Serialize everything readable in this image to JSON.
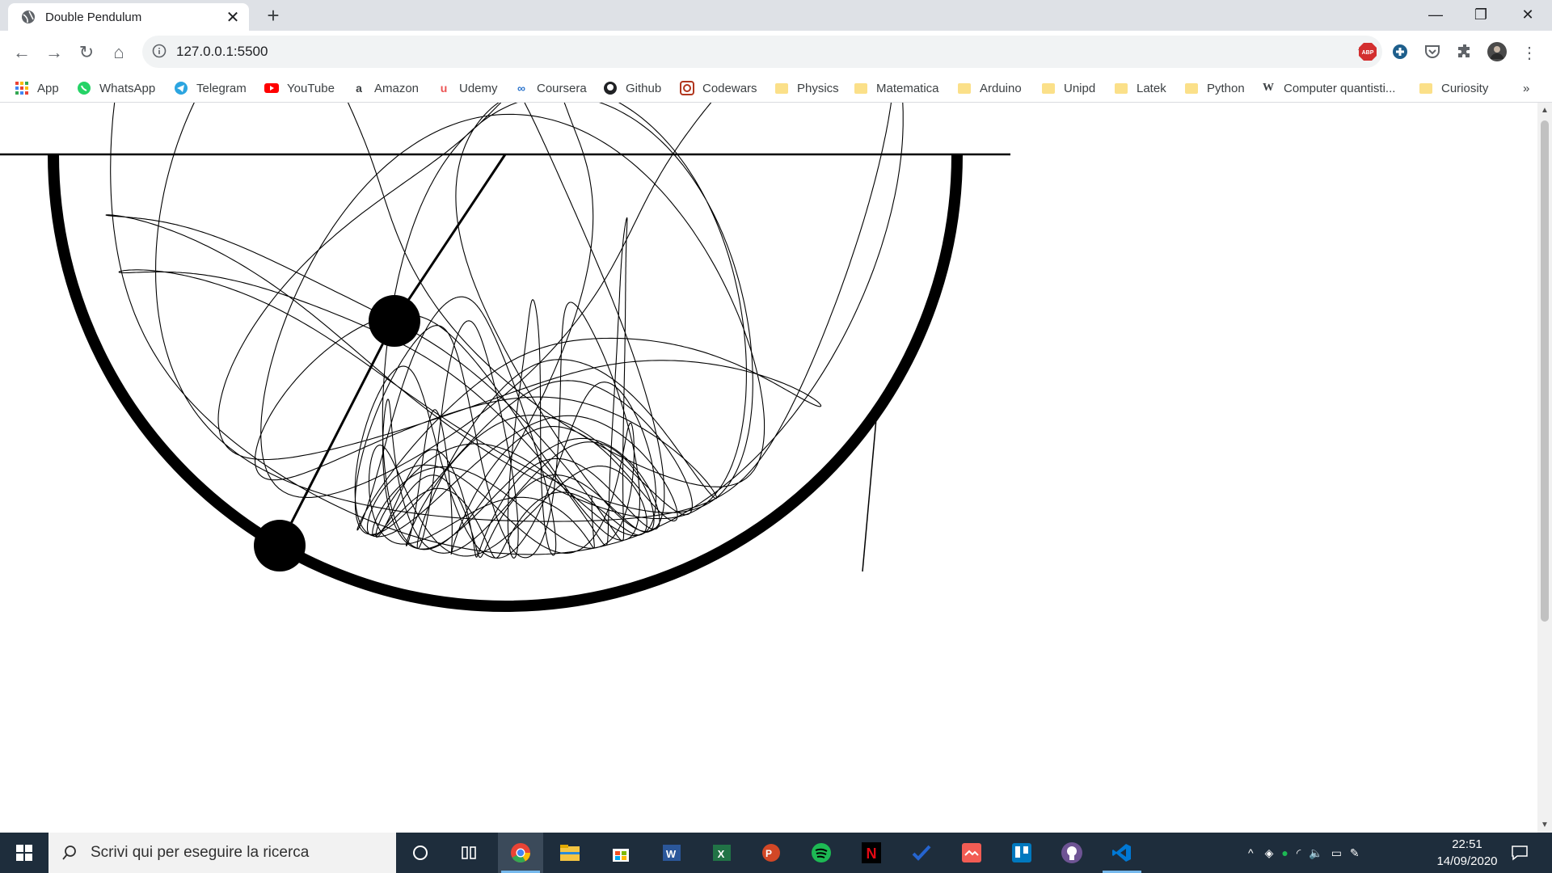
{
  "browser": {
    "tab_title": "Double Pendulum",
    "url": "127.0.0.1:5500",
    "new_tab_symbol": "+",
    "window_controls": [
      "minimize",
      "restore",
      "close"
    ]
  },
  "bookmarks": [
    {
      "label": "App",
      "icon": "apps-grid-icon"
    },
    {
      "label": "WhatsApp",
      "icon": "whatsapp-icon"
    },
    {
      "label": "Telegram",
      "icon": "telegram-icon"
    },
    {
      "label": "YouTube",
      "icon": "youtube-icon"
    },
    {
      "label": "Amazon",
      "icon": "amazon-icon"
    },
    {
      "label": "Udemy",
      "icon": "udemy-icon"
    },
    {
      "label": "Coursera",
      "icon": "coursera-icon"
    },
    {
      "label": "Github",
      "icon": "github-icon"
    },
    {
      "label": "Codewars",
      "icon": "codewars-icon"
    },
    {
      "label": "Physics",
      "icon": "folder-icon"
    },
    {
      "label": "Matematica",
      "icon": "folder-icon"
    },
    {
      "label": "Arduino",
      "icon": "folder-icon"
    },
    {
      "label": "Unipd",
      "icon": "folder-icon"
    },
    {
      "label": "Latek",
      "icon": "folder-icon"
    },
    {
      "label": "Python",
      "icon": "folder-icon"
    },
    {
      "label": "Computer quantisti...",
      "icon": "wikipedia-icon"
    },
    {
      "label": "Curiosity",
      "icon": "folder-icon"
    }
  ],
  "bookmarks_overflow": "»",
  "taskbar": {
    "search_placeholder": "Scrivi qui per eseguire la ricerca",
    "time": "22:51",
    "date": "14/09/2020",
    "apps": [
      "cortana-icon",
      "task-view-icon",
      "chrome-icon",
      "file-explorer-icon",
      "store-icon",
      "word-icon",
      "excel-icon",
      "powerpoint-icon",
      "spotify-icon",
      "netflix-icon",
      "todo-icon",
      "photos-icon",
      "trello-icon",
      "github-desktop-icon",
      "vscode-icon"
    ]
  }
}
